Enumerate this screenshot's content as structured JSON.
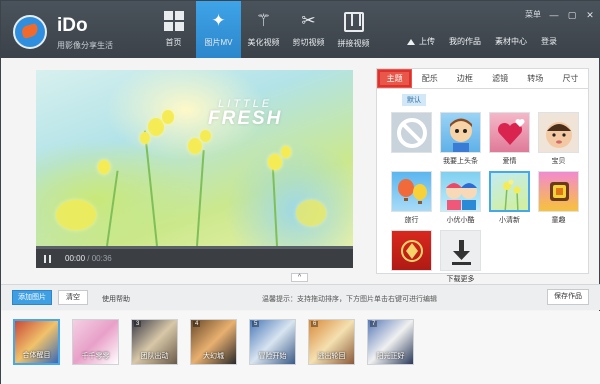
{
  "header": {
    "brand": "iDo",
    "slogan": "用影像分享生活",
    "nav": [
      {
        "label": "首页",
        "icon": "home-grid-icon"
      },
      {
        "label": "图片MV",
        "icon": "image-mv-icon",
        "active": true
      },
      {
        "label": "美化视频",
        "icon": "magic-wand-icon"
      },
      {
        "label": "剪切视频",
        "icon": "scissors-icon"
      },
      {
        "label": "拼接视频",
        "icon": "film-strip-icon"
      }
    ],
    "menu_label": "菜单",
    "window_controls": {
      "minimize": "—",
      "restore": "▢",
      "close": "✕"
    },
    "links": {
      "upload": "上传",
      "my_works": "我的作品",
      "material_center": "素材中心",
      "login": "登录"
    }
  },
  "player": {
    "title_line1": "LITTLE",
    "title_line2": "FRESH",
    "current_time": "00:00",
    "total_time": "/ 00:36",
    "progress": 0.0
  },
  "collapse_label": "^",
  "panel": {
    "tabs": [
      {
        "label": "主题",
        "active": true
      },
      {
        "label": "配乐"
      },
      {
        "label": "边框"
      },
      {
        "label": "滤镜"
      },
      {
        "label": "转场"
      },
      {
        "label": "尺寸"
      }
    ],
    "sub_tag": "默认",
    "themes": [
      {
        "caption": "",
        "icon": "none-icon"
      },
      {
        "caption": "我要上头条",
        "icon": "cartoon-boy-thumb"
      },
      {
        "caption": "爱情",
        "icon": "love-hearts-thumb"
      },
      {
        "caption": "宝贝",
        "icon": "baby-thumb"
      },
      {
        "caption": "旅行",
        "icon": "hot-air-balloon-thumb"
      },
      {
        "caption": "小优小酷",
        "icon": "cartoon-kids-thumb"
      },
      {
        "caption": "小清新",
        "icon": "fresh-flower-thumb",
        "selected": true
      },
      {
        "caption": "童趣",
        "icon": "colorful-box-thumb"
      },
      {
        "caption": "",
        "icon": "chinese-red-thumb"
      },
      {
        "caption": "下载更多",
        "icon": "download-icon"
      }
    ]
  },
  "bottom_bar": {
    "add_image": "添加图片",
    "clear": "清空",
    "help": "使用帮助",
    "tip": "温馨提示：支持拖动排序，下方图片单击右键可进行编辑",
    "save": "保存作品"
  },
  "timeline": {
    "clips": [
      {
        "num": "",
        "title": "合体醒目",
        "selected": true,
        "color": "#c84a3a"
      },
      {
        "num": "",
        "title": "千千零零",
        "color": "#e8a0c8"
      },
      {
        "num": "3",
        "title": "团队出动",
        "color": "#3a3a48"
      },
      {
        "num": "4",
        "title": "大幻城",
        "color": "#6a4a2a"
      },
      {
        "num": "5",
        "title": "冒险开始",
        "color": "#4a78b8"
      },
      {
        "num": "6",
        "title": "逃出轮回",
        "color": "#d88a3a"
      },
      {
        "num": "7",
        "title": "阳光正好",
        "color": "#5a7ab8"
      }
    ]
  }
}
